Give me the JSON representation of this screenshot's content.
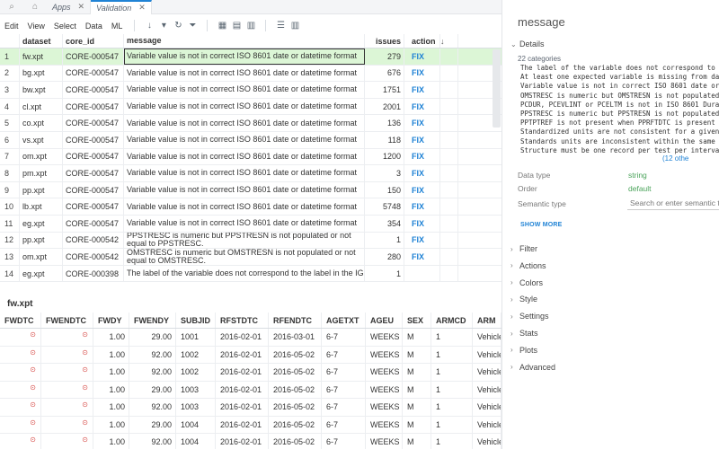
{
  "tabs": [
    {
      "label": "Apps"
    },
    {
      "label": "Validation"
    }
  ],
  "menu": [
    "Edit",
    "View",
    "Select",
    "Data",
    "ML"
  ],
  "top_grid": {
    "columns": [
      "dataset",
      "core_id",
      "message",
      "issues",
      "action"
    ],
    "rows": [
      {
        "idx": "1",
        "dataset": "fw.xpt",
        "core_id": "CORE-000547",
        "message": "Variable value is not in correct ISO 8601 date or datetime format",
        "issues": "279",
        "action": "FIX"
      },
      {
        "idx": "2",
        "dataset": "bg.xpt",
        "core_id": "CORE-000547",
        "message": "Variable value is not in correct ISO 8601 date or datetime format",
        "issues": "676",
        "action": "FIX"
      },
      {
        "idx": "3",
        "dataset": "bw.xpt",
        "core_id": "CORE-000547",
        "message": "Variable value is not in correct ISO 8601 date or datetime format",
        "issues": "1751",
        "action": "FIX"
      },
      {
        "idx": "4",
        "dataset": "cl.xpt",
        "core_id": "CORE-000547",
        "message": "Variable value is not in correct ISO 8601 date or datetime format",
        "issues": "2001",
        "action": "FIX"
      },
      {
        "idx": "5",
        "dataset": "co.xpt",
        "core_id": "CORE-000547",
        "message": "Variable value is not in correct ISO 8601 date or datetime format",
        "issues": "136",
        "action": "FIX"
      },
      {
        "idx": "6",
        "dataset": "vs.xpt",
        "core_id": "CORE-000547",
        "message": "Variable value is not in correct ISO 8601 date or datetime format",
        "issues": "118",
        "action": "FIX"
      },
      {
        "idx": "7",
        "dataset": "om.xpt",
        "core_id": "CORE-000547",
        "message": "Variable value is not in correct ISO 8601 date or datetime format",
        "issues": "1200",
        "action": "FIX"
      },
      {
        "idx": "8",
        "dataset": "pm.xpt",
        "core_id": "CORE-000547",
        "message": "Variable value is not in correct ISO 8601 date or datetime format",
        "issues": "3",
        "action": "FIX"
      },
      {
        "idx": "9",
        "dataset": "pp.xpt",
        "core_id": "CORE-000547",
        "message": "Variable value is not in correct ISO 8601 date or datetime format",
        "issues": "150",
        "action": "FIX"
      },
      {
        "idx": "10",
        "dataset": "lb.xpt",
        "core_id": "CORE-000547",
        "message": "Variable value is not in correct ISO 8601 date or datetime format",
        "issues": "5748",
        "action": "FIX"
      },
      {
        "idx": "11",
        "dataset": "eg.xpt",
        "core_id": "CORE-000547",
        "message": "Variable value is not in correct ISO 8601 date or datetime format",
        "issues": "354",
        "action": "FIX"
      },
      {
        "idx": "12",
        "dataset": "pp.xpt",
        "core_id": "CORE-000542",
        "message": "PPSTRESC is numeric but PPSTRESN is not populated or not equal to PPSTRESC.",
        "issues": "1",
        "action": "FIX"
      },
      {
        "idx": "13",
        "dataset": "om.xpt",
        "core_id": "CORE-000542",
        "message": "OMSTRESC is numeric but OMSTRESN is not populated or not equal to OMSTRESC.",
        "issues": "280",
        "action": "FIX"
      },
      {
        "idx": "14",
        "dataset": "eg.xpt",
        "core_id": "CORE-000398",
        "message": "The label of the variable does not correspond to the label in the IG",
        "issues": "1",
        "action": ""
      }
    ]
  },
  "bottom_title": "fw.xpt",
  "bottom_grid": {
    "columns": [
      "FWDTC",
      "FWENDTC",
      "FWDY",
      "FWENDY",
      "SUBJID",
      "RFSTDTC",
      "RFENDTC",
      "AGETXT",
      "AGEU",
      "SEX",
      "ARMCD",
      "ARM"
    ],
    "rows": [
      {
        "fwdy": "1.00",
        "fwendy": "29.00",
        "subjid": "1001",
        "rfstdtc": "2016-02-01",
        "rfendtc": "2016-03-01",
        "agetxt": "6-7",
        "ageu": "WEEKS",
        "sex": "M",
        "armcd": "1",
        "arm": "Vehicle"
      },
      {
        "fwdy": "1.00",
        "fwendy": "92.00",
        "subjid": "1002",
        "rfstdtc": "2016-02-01",
        "rfendtc": "2016-05-02",
        "agetxt": "6-7",
        "ageu": "WEEKS",
        "sex": "M",
        "armcd": "1",
        "arm": "Vehicle"
      },
      {
        "fwdy": "1.00",
        "fwendy": "92.00",
        "subjid": "1002",
        "rfstdtc": "2016-02-01",
        "rfendtc": "2016-05-02",
        "agetxt": "6-7",
        "ageu": "WEEKS",
        "sex": "M",
        "armcd": "1",
        "arm": "Vehicle"
      },
      {
        "fwdy": "1.00",
        "fwendy": "29.00",
        "subjid": "1003",
        "rfstdtc": "2016-02-01",
        "rfendtc": "2016-05-02",
        "agetxt": "6-7",
        "ageu": "WEEKS",
        "sex": "M",
        "armcd": "1",
        "arm": "Vehicle"
      },
      {
        "fwdy": "1.00",
        "fwendy": "92.00",
        "subjid": "1003",
        "rfstdtc": "2016-02-01",
        "rfendtc": "2016-05-02",
        "agetxt": "6-7",
        "ageu": "WEEKS",
        "sex": "M",
        "armcd": "1",
        "arm": "Vehicle"
      },
      {
        "fwdy": "1.00",
        "fwendy": "29.00",
        "subjid": "1004",
        "rfstdtc": "2016-02-01",
        "rfendtc": "2016-05-02",
        "agetxt": "6-7",
        "ageu": "WEEKS",
        "sex": "M",
        "armcd": "1",
        "arm": "Vehicle"
      },
      {
        "fwdy": "1.00",
        "fwendy": "92.00",
        "subjid": "1004",
        "rfstdtc": "2016-02-01",
        "rfendtc": "2016-05-02",
        "agetxt": "6-7",
        "ageu": "WEEKS",
        "sex": "M",
        "armcd": "1",
        "arm": "Vehicle"
      }
    ]
  },
  "panel": {
    "title": "message",
    "details_label": "Details",
    "categories_count": "22 categories",
    "categories": [
      "The label of the variable does not correspond to t",
      "At least one expected variable is missing from dat",
      "Variable value is not in correct ISO 8601 date or",
      "OMSTRESC is numeric but OMSTRESN is not populated",
      "PCDUR, PCEVLINT or PCELTM is not in ISO 8601 Durat",
      "PPSTRESC is numeric but PPSTRESN is not populated",
      "PPTPTREF is not present when PPRFTDTC is present i",
      "Standardized units are not consistent for a given",
      "Standards units are inconsistent within the same t",
      "Structure must be one record per test per interval"
    ],
    "more": "(12 othe",
    "data_type_label": "Data type",
    "data_type_value": "string",
    "order_label": "Order",
    "order_value": "default",
    "semantic_label": "Semantic type",
    "semantic_placeholder": "Search or enter semantic t",
    "show_more": "SHOW MORE",
    "sections": [
      "Filter",
      "Actions",
      "Colors",
      "Style",
      "Settings",
      "Stats",
      "Plots",
      "Advanced"
    ]
  }
}
